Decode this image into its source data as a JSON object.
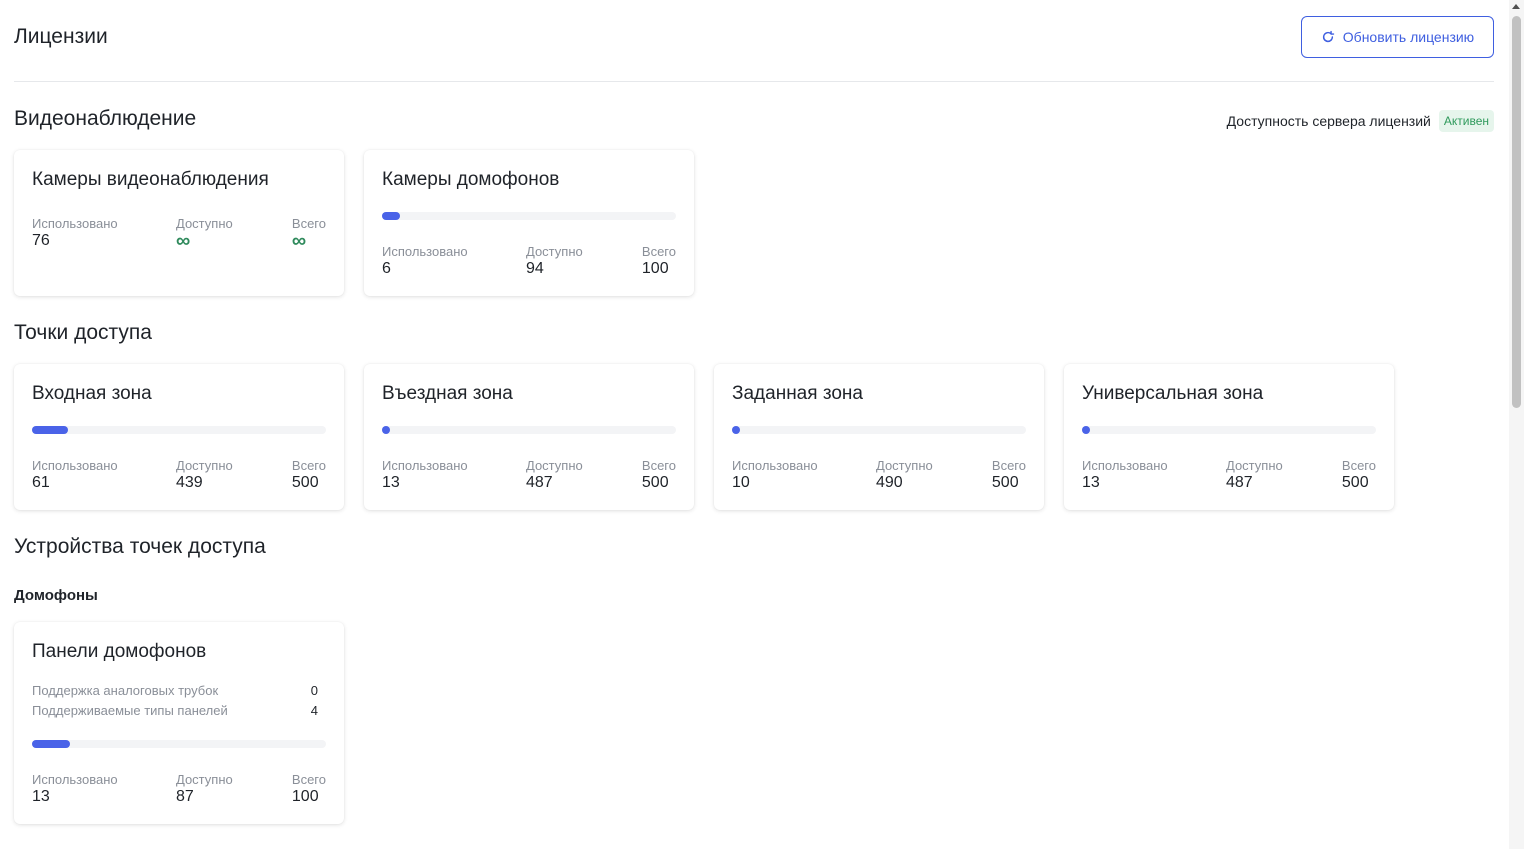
{
  "header": {
    "title": "Лицензии",
    "refresh_label": "Обновить лицензию"
  },
  "stat_labels": {
    "used": "Использовано",
    "available": "Доступно",
    "total": "Всего"
  },
  "video": {
    "title": "Видеонаблюдение",
    "server_label": "Доступность сервера лицензий",
    "server_status": "Активен",
    "cards": [
      {
        "title": "Камеры видеонаблюдения",
        "used": "76",
        "available": "∞",
        "total": "∞"
      },
      {
        "title": "Камеры домофонов",
        "used": "6",
        "available": "94",
        "total": "100",
        "usage_fraction": 0.06
      }
    ]
  },
  "access_points": {
    "title": "Точки доступа",
    "cards": [
      {
        "title": "Входная зона",
        "used": "61",
        "available": "439",
        "total": "500",
        "usage_fraction": 0.122
      },
      {
        "title": "Въездная зона",
        "used": "13",
        "available": "487",
        "total": "500",
        "usage_fraction": 0.026
      },
      {
        "title": "Заданная зона",
        "used": "10",
        "available": "490",
        "total": "500",
        "usage_fraction": 0.02
      },
      {
        "title": "Универсальная зона",
        "used": "13",
        "available": "487",
        "total": "500",
        "usage_fraction": 0.026
      }
    ]
  },
  "devices": {
    "title": "Устройства точек доступа",
    "subsection": "Домофоны",
    "card": {
      "title": "Панели домофонов",
      "analog_label": "Поддержка аналоговых трубок",
      "analog_value": "0",
      "panel_types_label": "Поддерживаемые типы панелей",
      "panel_types_value": "4",
      "used": "13",
      "available": "87",
      "total": "100",
      "usage_fraction": 0.13
    }
  },
  "colors": {
    "accent": "#4a63e8",
    "status_active": "#2f9a5c"
  }
}
